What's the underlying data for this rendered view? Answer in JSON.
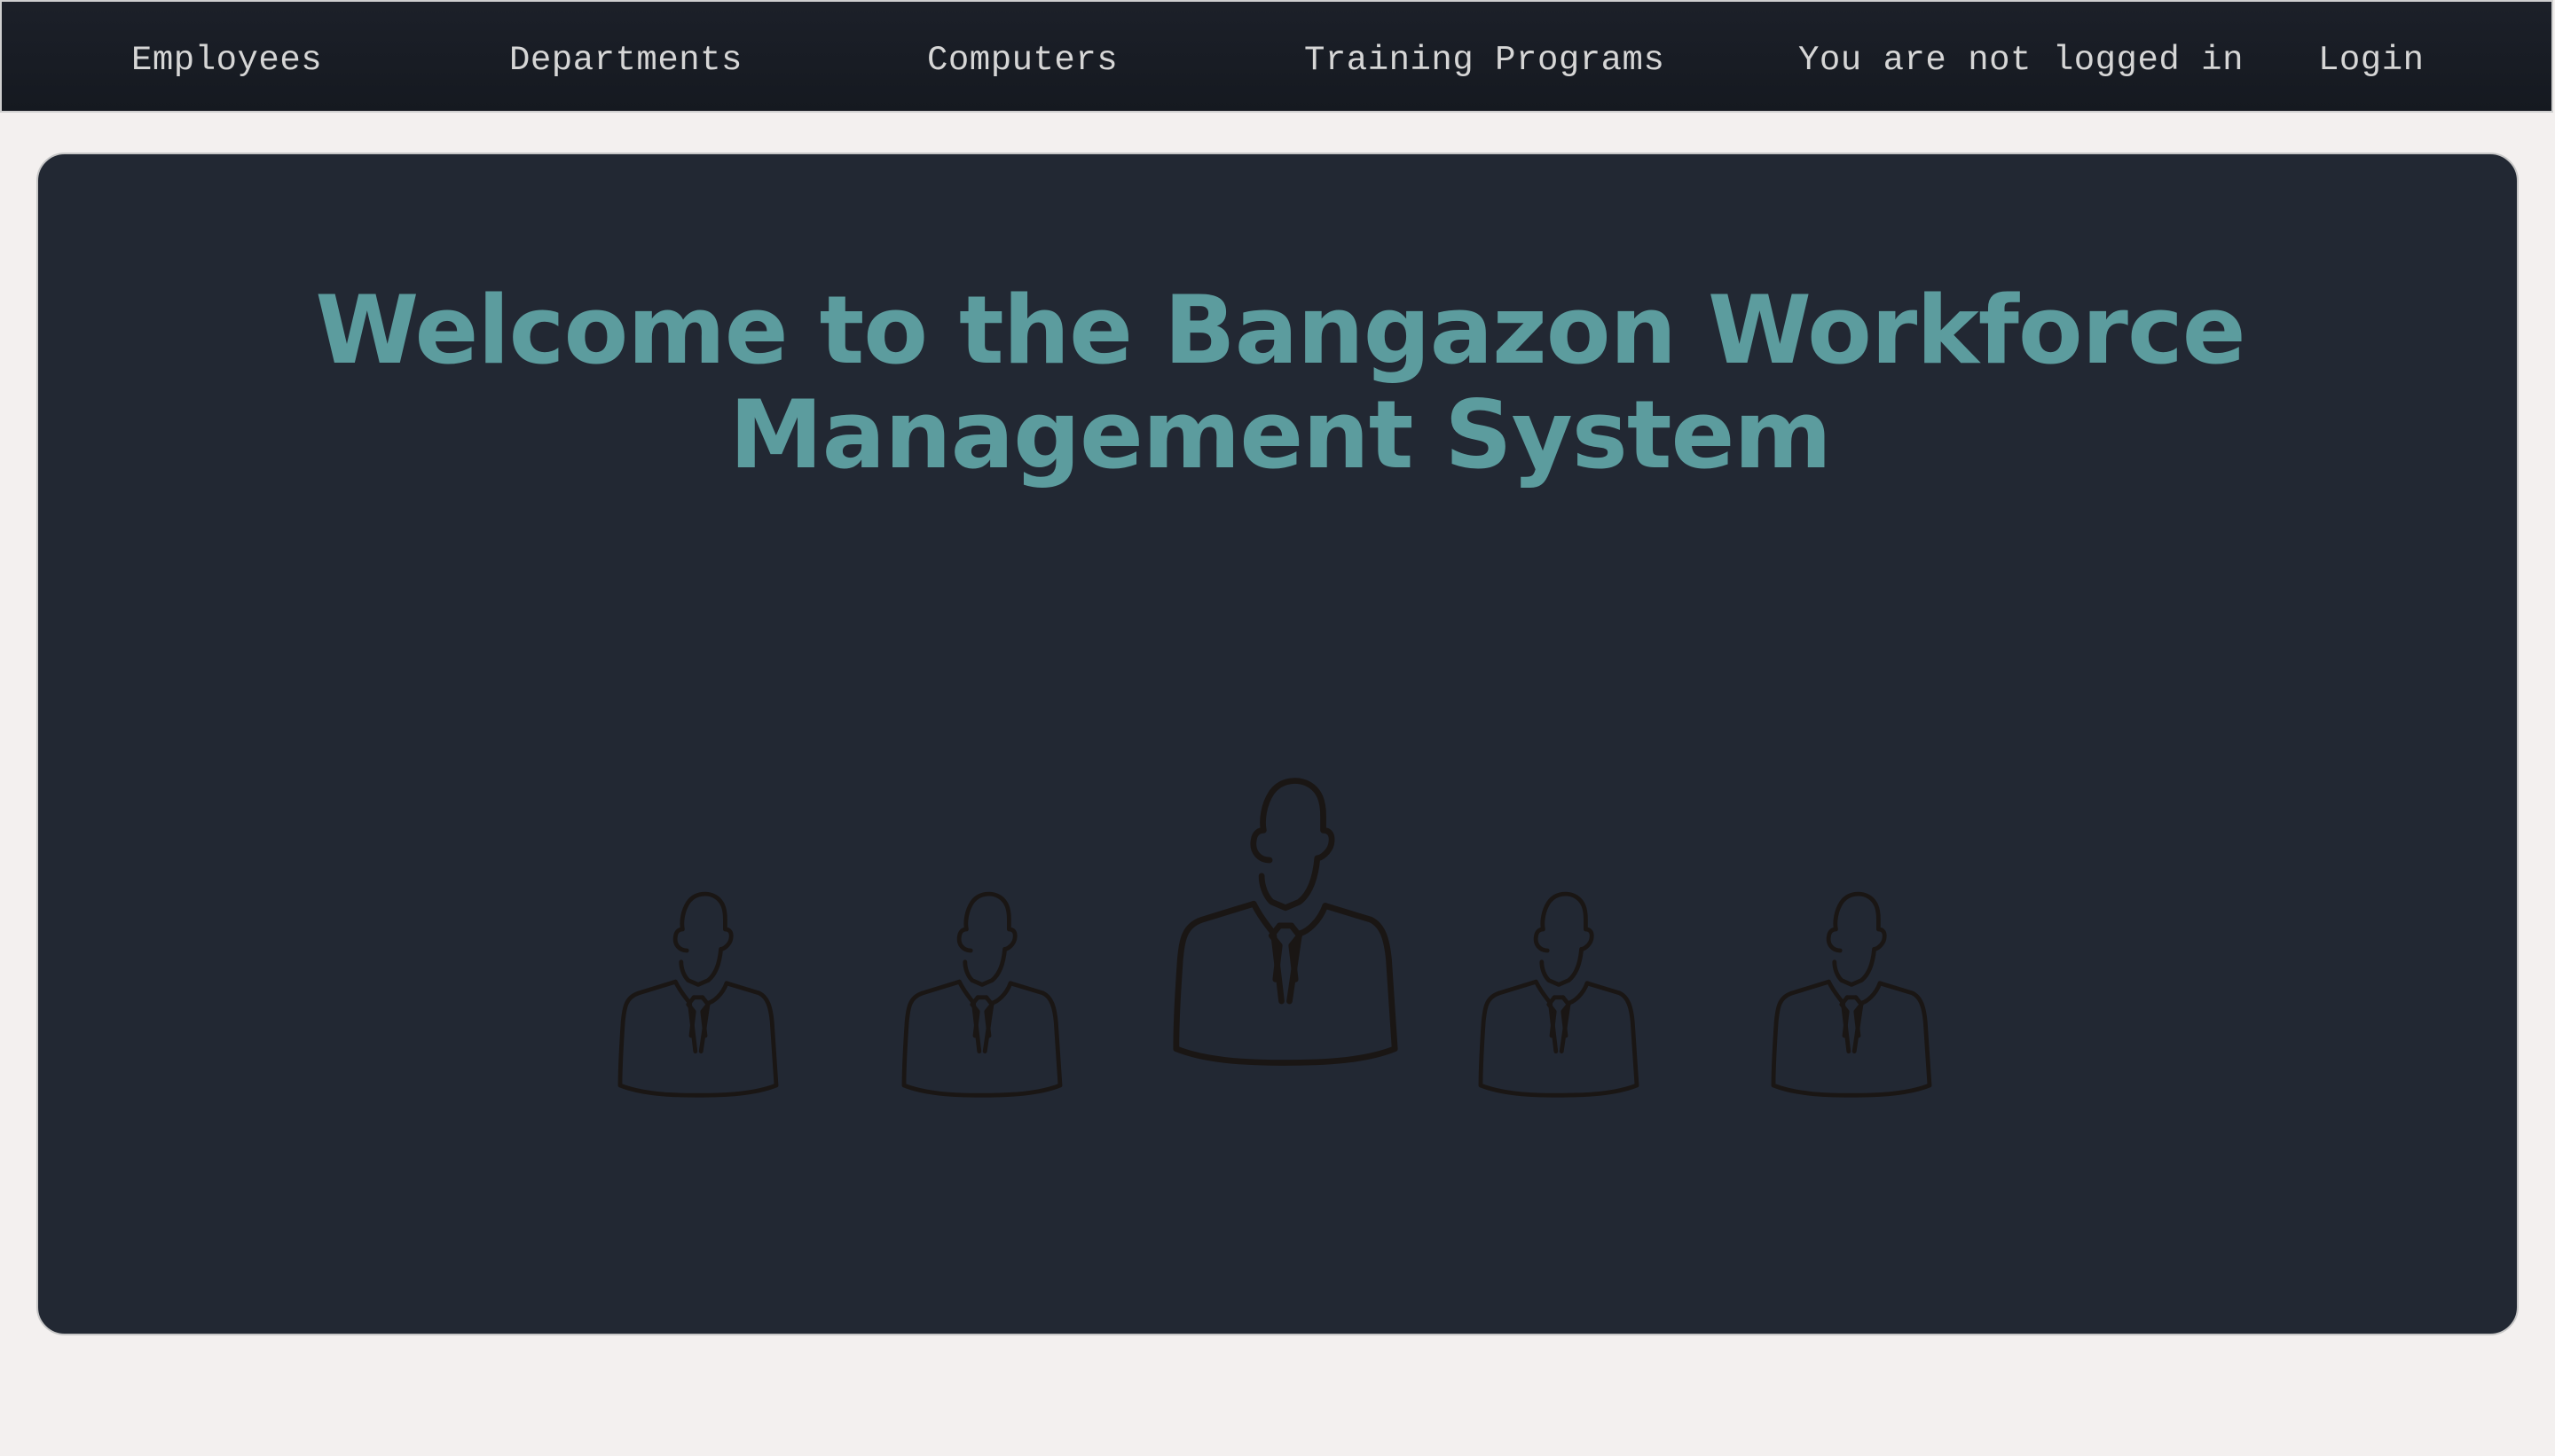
{
  "nav": {
    "employees": "Employees",
    "departments": "Departments",
    "computers": "Computers",
    "training_programs": "Training Programs",
    "login_status": "You are not logged in",
    "login": "Login"
  },
  "hero": {
    "title": "Welcome to the Bangazon Workforce Management System",
    "illustration": "group-of-employees-icon"
  },
  "colors": {
    "nav_background": "#181c24",
    "nav_text": "#d6d6d6",
    "page_background": "#f3f0ef",
    "card_background": "#222833",
    "title_color": "#5c9c9e",
    "illustration_stroke": "#1a1614"
  }
}
